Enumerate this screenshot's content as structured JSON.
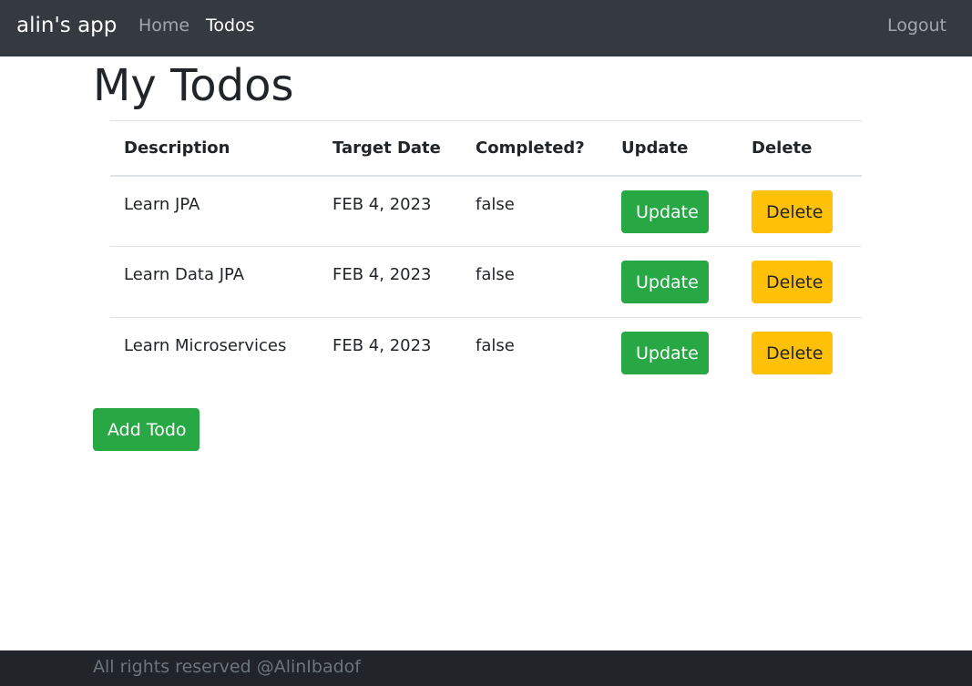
{
  "navbar": {
    "brand": "alin's app",
    "links": [
      {
        "label": "Home",
        "active": false
      },
      {
        "label": "Todos",
        "active": true
      }
    ],
    "logout": "Logout"
  },
  "page": {
    "title": "My Todos"
  },
  "table": {
    "headers": [
      "Description",
      "Target Date",
      "Completed?",
      "Update",
      "Delete"
    ],
    "rows": [
      {
        "description": "Learn JPA",
        "target_date": "FEB 4, 2023",
        "completed": "false",
        "update_label": "Update",
        "delete_label": "Delete"
      },
      {
        "description": "Learn Data JPA",
        "target_date": "FEB 4, 2023",
        "completed": "false",
        "update_label": "Update",
        "delete_label": "Delete"
      },
      {
        "description": "Learn Microservices",
        "target_date": "FEB 4, 2023",
        "completed": "false",
        "update_label": "Update",
        "delete_label": "Delete"
      }
    ]
  },
  "actions": {
    "add_label": "Add Todo"
  },
  "footer": {
    "text": "All rights reserved @AlinIbadof"
  },
  "colors": {
    "navbar_bg": "#343a40",
    "success": "#28a745",
    "warning": "#ffc107",
    "footer_bg": "#212529"
  }
}
